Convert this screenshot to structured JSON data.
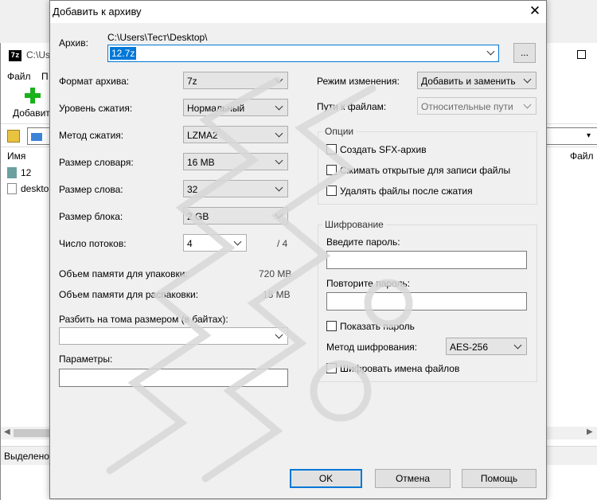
{
  "background_window": {
    "app_icon": "7z",
    "title_path": "C:\\Use",
    "menu": [
      "Файл",
      "П"
    ],
    "toolbar_add_label": "Добавить",
    "column_name": "Имя",
    "column_right": "Файл",
    "items": [
      {
        "name": "12",
        "icon": "archive-icon"
      },
      {
        "name": "desktop",
        "icon": "file-icon"
      }
    ],
    "status": "Выделено"
  },
  "dialog": {
    "title": "Добавить к архиву",
    "archive_label": "Архив:",
    "archive_path": "C:\\Users\\Тест\\Desktop\\",
    "archive_name": "12.7z",
    "browse_label": "...",
    "left": {
      "format_label": "Формат архива:",
      "format_value": "7z",
      "level_label": "Уровень сжатия:",
      "level_value": "Нормальный",
      "method_label": "Метод сжатия:",
      "method_value": "LZMA2",
      "dict_label": "Размер словаря:",
      "dict_value": "16 MB",
      "word_label": "Размер слова:",
      "word_value": "32",
      "block_label": "Размер блока:",
      "block_value": "2 GB",
      "threads_label": "Число потоков:",
      "threads_value": "4",
      "threads_max": "/ 4",
      "mem_pack_label": "Объем памяти для упаковки:",
      "mem_pack_value": "720 MB",
      "mem_unpack_label": "Объем памяти для распаковки:",
      "mem_unpack_value": "18 MB",
      "split_label": "Разбить на тома размером (в байтах):",
      "split_value": "",
      "params_label": "Параметры:",
      "params_value": ""
    },
    "right": {
      "update_label": "Режим изменения:",
      "update_value": "Добавить и заменить",
      "paths_label": "Пути к файлам:",
      "paths_value": "Относительные пути",
      "options_title": "Опции",
      "opt_sfx": "Создать SFX-архив",
      "opt_shared": "Сжимать открытые для записи файлы",
      "opt_delete": "Удалять файлы после сжатия",
      "encryption_title": "Шифрование",
      "enter_password_label": "Введите пароль:",
      "repeat_password_label": "Повторите пароль:",
      "show_password_label": "Показать пароль",
      "enc_method_label": "Метод шифрования:",
      "enc_method_value": "AES-256",
      "encrypt_names_label": "Шифровать имена файлов"
    },
    "buttons": {
      "ok": "OK",
      "cancel": "Отмена",
      "help": "Помощь"
    }
  },
  "colors": {
    "accent": "#0078d7",
    "dialog_bg": "#f0f0f0",
    "button_bg": "#e1e1e1",
    "add_icon_green": "#19b219"
  }
}
